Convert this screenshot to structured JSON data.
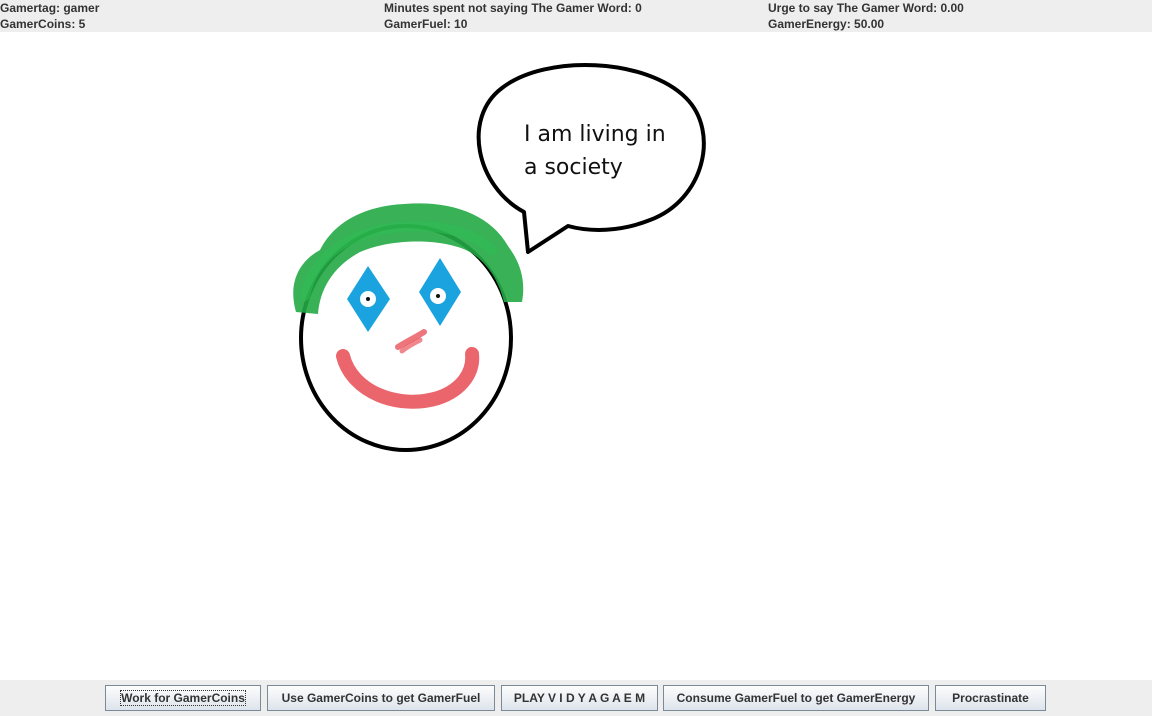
{
  "stats": {
    "gamertag": "Gamertag: gamer",
    "gamercoins": "GamerCoins: 5",
    "minutes": "Minutes spent not saying The Gamer Word: 0",
    "gamerfuel": "GamerFuel: 10",
    "urge": "Urge to say The Gamer Word: 0.00",
    "gamerenergy": "GamerEnergy: 50.00"
  },
  "speech": {
    "line1": "I am living in",
    "line2": "a society"
  },
  "buttons": {
    "work": "Work for GamerCoins",
    "buy_fuel": "Use GamerCoins to get GamerFuel",
    "play": "PLAY V I D Y A G A E M",
    "consume": "Consume GamerFuel to get GamerEnergy",
    "procrastinate": "Procrastinate"
  },
  "colors": {
    "hair": "#22a845",
    "eyes": "#1ba3e0",
    "mouth": "#e8545c",
    "outline": "#000000",
    "panel": "#eeeeee"
  }
}
